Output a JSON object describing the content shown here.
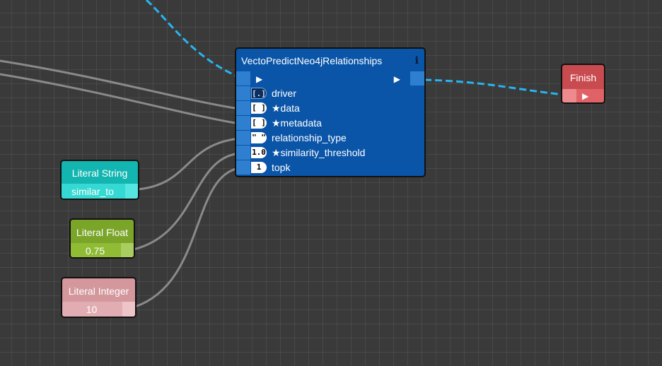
{
  "main_node": {
    "title": "VectoPredictNeo4jRelationships",
    "info_icon": "i",
    "inputs": [
      {
        "badge": "[.]",
        "label": "driver"
      },
      {
        "badge": "[ ]",
        "label": "★data"
      },
      {
        "badge": "[ ]",
        "label": "★metadata"
      },
      {
        "badge": "\" \"",
        "label": "relationship_type"
      },
      {
        "badge": "1.0",
        "label": "★similarity_threshold"
      },
      {
        "badge": "1",
        "label": "topk"
      }
    ],
    "color": "#0a55a8"
  },
  "finish_node": {
    "title": "Finish",
    "color": "#c84b4f"
  },
  "literal_string": {
    "title": "Literal String",
    "value": "similar_to",
    "color": "#12b5b0"
  },
  "literal_float": {
    "title": "Literal Float",
    "value": "0.75",
    "color": "#7aa529"
  },
  "literal_integer": {
    "title": "Literal Integer",
    "value": "10",
    "color": "#d3979c"
  },
  "wire_colors": {
    "exec": "#27b4f0",
    "data": "#8a8a8a"
  }
}
